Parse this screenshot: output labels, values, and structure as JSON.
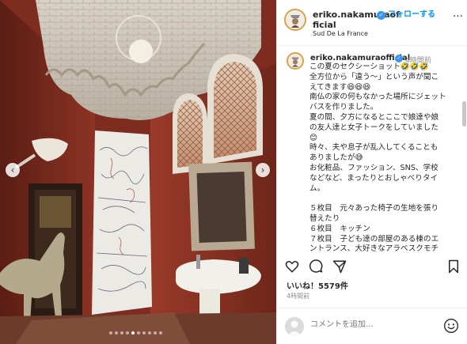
{
  "post": {
    "username": "eriko.nakamuraofficial",
    "username_header_lines": [
      "eriko.nakamuraof",
      "ficial"
    ],
    "follow_label": "フォローする",
    "more_label": "…",
    "location": "Sud De La France",
    "time_ago": "4時間前",
    "caption_lines": [
      "この夏のセクシーショット🤣🤣🤣",
      "全方位から「違う〜」という声が聞こ",
      "えてきます😆😆😆",
      "南仏の家の何もなかった場所にジェット",
      "バスを作りました。",
      "夏の間、夕方になるとここで娘達や娘",
      "の友人達と女子トークをしていました",
      "😊",
      "時々、夫や息子が乱入してくることも",
      "ありましたが😅",
      "お化粧品、ファッション、SNS、学校",
      "などなど、まったりとおしゃべりタイ",
      "ム。",
      "",
      "５枚目　元々あった椅子の生地を張り",
      "替えたり",
      "６枚目　キッチン",
      "７枚目　子ども達の部屋のある棟のエ",
      "ントランス、大好きなアラベスクモチ"
    ],
    "likes": "いいね！5579件",
    "post_time": "4時間前",
    "comment_placeholder": "コメントを追加...",
    "carousel": {
      "total_slides": 10,
      "active_slide": 4
    }
  },
  "icons": {
    "verified": "verified-badge-icon",
    "like": "heart-icon",
    "comment": "comment-icon",
    "share": "send-icon",
    "save": "bookmark-icon",
    "emoji": "smiley-icon",
    "prev": "chevron-left-icon",
    "next": "chevron-right-icon"
  },
  "colors": {
    "accent": "#0095f6",
    "verified": "#3897f0",
    "wall": "#8a2f22",
    "muted": "#8e8e8e"
  }
}
